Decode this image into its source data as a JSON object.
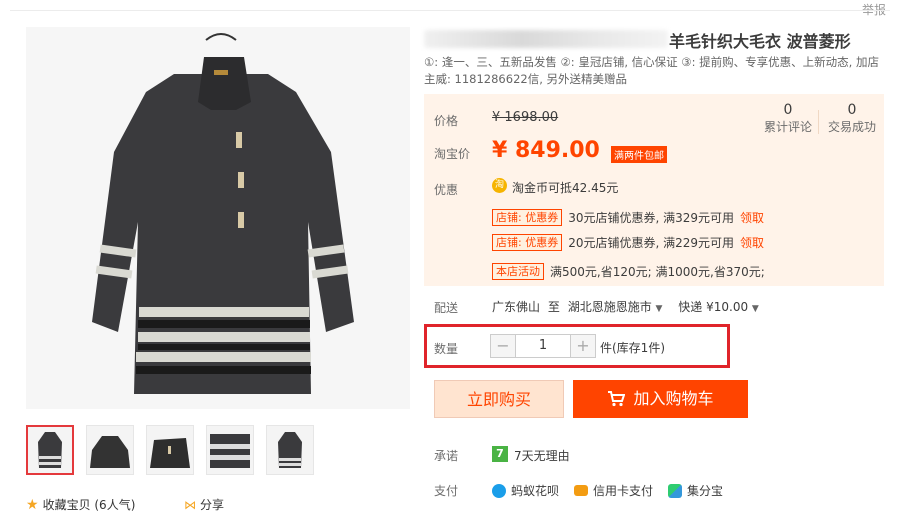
{
  "header": {
    "report_label": "举报"
  },
  "product": {
    "title": "羊毛针织大毛衣 波普菱形",
    "subtitle": "①: 逢一、三、五新品发售 ②: 皇冠店铺, 信心保证 ③: 提前购、专享优惠、上新动态, 加店主威: 1181286622信, 另外送精美赠品"
  },
  "price": {
    "price_label": "价格",
    "original": "¥ 1698.00",
    "taobao_label": "淘宝价",
    "current": "¥ 849.00",
    "ship_badge": "满两件包邮",
    "reviews": {
      "count": "0",
      "label": "累计评论"
    },
    "sales": {
      "count": "0",
      "label": "交易成功"
    }
  },
  "promo": {
    "label": "优惠",
    "coin_icon": "淘",
    "coin_text": "淘金币可抵42.45元",
    "coupons": [
      {
        "tag": "店铺: 优惠券",
        "text": "30元店铺优惠券, 满329元可用",
        "action": "领取"
      },
      {
        "tag": "店铺: 优惠券",
        "text": "20元店铺优惠券, 满229元可用",
        "action": "领取"
      }
    ],
    "store_event": {
      "tag": "本店活动",
      "text": "满500元,省120元; 满1000元,省370元;"
    }
  },
  "delivery": {
    "label": "配送",
    "from": "广东佛山",
    "to_word": "至",
    "to": "湖北恩施恩施市",
    "method": "快递 ¥10.00"
  },
  "quantity": {
    "label": "数量",
    "value": "1",
    "minus": "−",
    "plus": "+",
    "stock": "件(库存1件)"
  },
  "actions": {
    "buy_now": "立即购买",
    "add_cart": "加入购物车"
  },
  "promise": {
    "label": "承诺",
    "icon": "7",
    "text": "7天无理由"
  },
  "payment": {
    "label": "支付",
    "methods": [
      "蚂蚁花呗",
      "信用卡支付",
      "集分宝"
    ]
  },
  "gallery": {
    "favorite": "收藏宝贝 (6人气)",
    "share": "分享"
  },
  "colors": {
    "accent": "#ff4400",
    "panel_bg": "#fff3e9",
    "highlight_border": "#e0242a"
  }
}
